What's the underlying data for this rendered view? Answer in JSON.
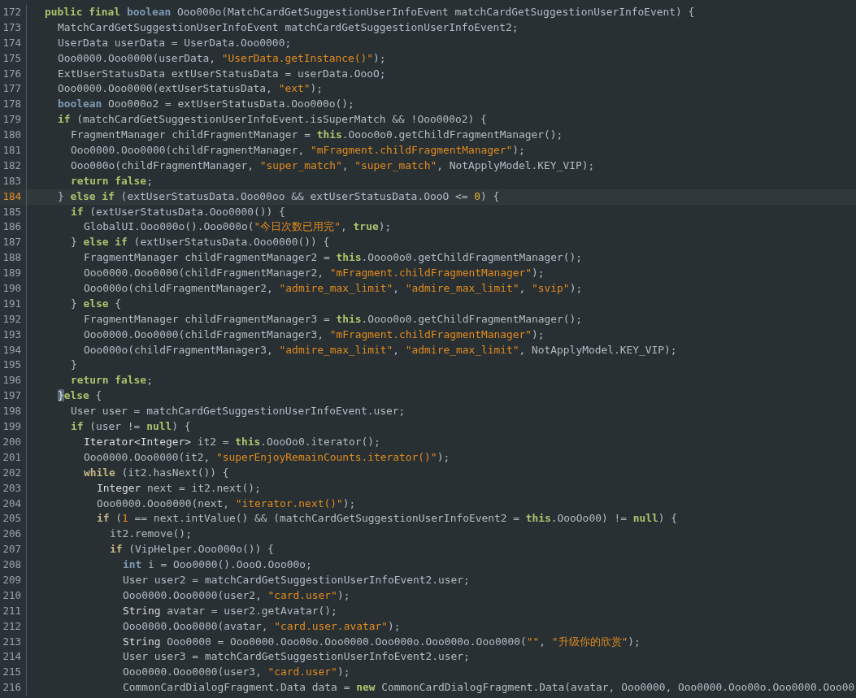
{
  "editor": {
    "lines": [
      {
        "number": "172",
        "current": false,
        "segments": [
          {
            "kind": "keyword",
            "text": "public final "
          },
          {
            "kind": "type",
            "text": "boolean"
          },
          {
            "kind": "plain",
            "text": " Ooo000o(MatchCardGetSuggestionUserInfoEvent matchCardGetSuggestionUserInfoEvent) {"
          }
        ]
      },
      {
        "number": "173",
        "current": false,
        "segments": [
          {
            "kind": "plain",
            "text": "MatchCardGetSuggestionUserInfoEvent matchCardGetSuggestionUserInfoEvent2;"
          }
        ]
      },
      {
        "number": "174",
        "current": false,
        "segments": [
          {
            "kind": "plain",
            "text": "UserData userData = UserData.Ooo0000;"
          }
        ]
      },
      {
        "number": "175",
        "current": false,
        "segments": [
          {
            "kind": "plain",
            "text": "Ooo0000.Ooo0000(userData, "
          },
          {
            "kind": "string",
            "text": "\"UserData.getInstance()\""
          },
          {
            "kind": "plain",
            "text": ");"
          }
        ]
      },
      {
        "number": "176",
        "current": false,
        "segments": [
          {
            "kind": "plain",
            "text": "ExtUserStatusData extUserStatusData = userData.OooO;"
          }
        ]
      },
      {
        "number": "177",
        "current": false,
        "segments": [
          {
            "kind": "plain",
            "text": "Ooo0000.Ooo0000(extUserStatusData, "
          },
          {
            "kind": "string",
            "text": "\"ext\""
          },
          {
            "kind": "plain",
            "text": ");"
          }
        ]
      },
      {
        "number": "178",
        "current": false,
        "segments": [
          {
            "kind": "type",
            "text": "boolean"
          },
          {
            "kind": "plain",
            "text": " Ooo000o2 = extUserStatusData.Ooo000o();"
          }
        ]
      },
      {
        "number": "179",
        "current": false,
        "segments": [
          {
            "kind": "keyword",
            "text": "if"
          },
          {
            "kind": "plain",
            "text": " (matchCardGetSuggestionUserInfoEvent.isSuperMatch && !Ooo000o2) {"
          }
        ]
      },
      {
        "number": "180",
        "current": false,
        "segments": [
          {
            "kind": "plain",
            "text": "FragmentManager childFragmentManager = "
          },
          {
            "kind": "keyword",
            "text": "this"
          },
          {
            "kind": "plain",
            "text": ".Oooo0o0.getChildFragmentManager();"
          }
        ]
      },
      {
        "number": "181",
        "current": false,
        "segments": [
          {
            "kind": "plain",
            "text": "Ooo0000.Ooo0000(childFragmentManager, "
          },
          {
            "kind": "string",
            "text": "\"mFragment.childFragmentManager\""
          },
          {
            "kind": "plain",
            "text": ");"
          }
        ]
      },
      {
        "number": "182",
        "current": false,
        "segments": [
          {
            "kind": "plain",
            "text": "Ooo000o(childFragmentManager, "
          },
          {
            "kind": "string",
            "text": "\"super_match\""
          },
          {
            "kind": "plain",
            "text": ", "
          },
          {
            "kind": "string",
            "text": "\"super_match\""
          },
          {
            "kind": "plain",
            "text": ", NotApplyModel.KEY_VIP);"
          }
        ]
      },
      {
        "number": "183",
        "current": false,
        "segments": [
          {
            "kind": "keyword",
            "text": "return false"
          },
          {
            "kind": "plain",
            "text": ";"
          }
        ]
      },
      {
        "number": "184",
        "current": true,
        "segments": [
          {
            "kind": "plain",
            "text": "} "
          },
          {
            "kind": "keyword",
            "text": "else if"
          },
          {
            "kind": "plain",
            "text": " (extUserStatusData.Ooo00oo && extUserStatusData.OooO <= "
          },
          {
            "kind": "number",
            "text": "0"
          },
          {
            "kind": "plain",
            "text": ") {"
          }
        ]
      },
      {
        "number": "185",
        "current": false,
        "segments": [
          {
            "kind": "keyword",
            "text": "if"
          },
          {
            "kind": "plain",
            "text": " (extUserStatusData.Ooo0000()) {"
          }
        ]
      },
      {
        "number": "186",
        "current": false,
        "segments": [
          {
            "kind": "plain",
            "text": "GlobalUI.Ooo000o().Ooo000o("
          },
          {
            "kind": "string",
            "text": "\"今日次数已用完\""
          },
          {
            "kind": "plain",
            "text": ", "
          },
          {
            "kind": "keyword",
            "text": "true"
          },
          {
            "kind": "plain",
            "text": ");"
          }
        ]
      },
      {
        "number": "187",
        "current": false,
        "segments": [
          {
            "kind": "plain",
            "text": "} "
          },
          {
            "kind": "keyword",
            "text": "else if"
          },
          {
            "kind": "plain",
            "text": " (extUserStatusData.Ooo0000()) {"
          }
        ]
      },
      {
        "number": "188",
        "current": false,
        "segments": [
          {
            "kind": "plain",
            "text": "FragmentManager childFragmentManager2 = "
          },
          {
            "kind": "keyword",
            "text": "this"
          },
          {
            "kind": "plain",
            "text": ".Oooo0o0.getChildFragmentManager();"
          }
        ]
      },
      {
        "number": "189",
        "current": false,
        "segments": [
          {
            "kind": "plain",
            "text": "Ooo0000.Ooo0000(childFragmentManager2, "
          },
          {
            "kind": "string",
            "text": "\"mFragment.childFragmentManager\""
          },
          {
            "kind": "plain",
            "text": ");"
          }
        ]
      },
      {
        "number": "190",
        "current": false,
        "segments": [
          {
            "kind": "plain",
            "text": "Ooo000o(childFragmentManager2, "
          },
          {
            "kind": "string",
            "text": "\"admire_max_limit\""
          },
          {
            "kind": "plain",
            "text": ", "
          },
          {
            "kind": "string",
            "text": "\"admire_max_limit\""
          },
          {
            "kind": "plain",
            "text": ", "
          },
          {
            "kind": "string",
            "text": "\"svip\""
          },
          {
            "kind": "plain",
            "text": ");"
          }
        ]
      },
      {
        "number": "191",
        "current": false,
        "segments": [
          {
            "kind": "plain",
            "text": "} "
          },
          {
            "kind": "keyword",
            "text": "else"
          },
          {
            "kind": "plain",
            "text": " {"
          }
        ]
      },
      {
        "number": "192",
        "current": false,
        "segments": [
          {
            "kind": "plain",
            "text": "FragmentManager childFragmentManager3 = "
          },
          {
            "kind": "keyword",
            "text": "this"
          },
          {
            "kind": "plain",
            "text": ".Oooo0o0.getChildFragmentManager();"
          }
        ]
      },
      {
        "number": "193",
        "current": false,
        "segments": [
          {
            "kind": "plain",
            "text": "Ooo0000.Ooo0000(childFragmentManager3, "
          },
          {
            "kind": "string",
            "text": "\"mFragment.childFragmentManager\""
          },
          {
            "kind": "plain",
            "text": ");"
          }
        ]
      },
      {
        "number": "194",
        "current": false,
        "segments": [
          {
            "kind": "plain",
            "text": "Ooo000o(childFragmentManager3, "
          },
          {
            "kind": "string",
            "text": "\"admire_max_limit\""
          },
          {
            "kind": "plain",
            "text": ", "
          },
          {
            "kind": "string",
            "text": "\"admire_max_limit\""
          },
          {
            "kind": "plain",
            "text": ", NotApplyModel.KEY_VIP);"
          }
        ]
      },
      {
        "number": "195",
        "current": false,
        "segments": [
          {
            "kind": "plain",
            "text": "}"
          }
        ]
      },
      {
        "number": "196",
        "current": false,
        "segments": [
          {
            "kind": "keyword",
            "text": "return false"
          },
          {
            "kind": "plain",
            "text": ";"
          }
        ]
      },
      {
        "number": "197",
        "current": false,
        "segments": [
          {
            "kind": "brace-match",
            "text": "}"
          },
          {
            "kind": "keyword",
            "text": "else"
          },
          {
            "kind": "plain",
            "text": " {"
          }
        ]
      },
      {
        "number": "198",
        "current": false,
        "segments": [
          {
            "kind": "plain",
            "text": "User user = matchCardGetSuggestionUserInfoEvent.user;"
          }
        ]
      },
      {
        "number": "199",
        "current": false,
        "segments": [
          {
            "kind": "keyword",
            "text": "if"
          },
          {
            "kind": "plain",
            "text": " (user != "
          },
          {
            "kind": "keyword",
            "text": "null"
          },
          {
            "kind": "plain",
            "text": ") {"
          }
        ]
      },
      {
        "number": "200",
        "current": false,
        "segments": [
          {
            "kind": "class",
            "text": "Iterator<Integer>"
          },
          {
            "kind": "plain",
            "text": " it2 = "
          },
          {
            "kind": "keyword",
            "text": "this"
          },
          {
            "kind": "plain",
            "text": ".OooOo0.iterator();"
          }
        ]
      },
      {
        "number": "201",
        "current": false,
        "segments": [
          {
            "kind": "plain",
            "text": "Ooo0000.Ooo0000(it2, "
          },
          {
            "kind": "string",
            "text": "\"superEnjoyRemainCounts.iterator()\""
          },
          {
            "kind": "plain",
            "text": ");"
          }
        ]
      },
      {
        "number": "202",
        "current": false,
        "segments": [
          {
            "kind": "flow",
            "text": "while"
          },
          {
            "kind": "plain",
            "text": " (it2.hasNext()) {"
          }
        ]
      },
      {
        "number": "203",
        "current": false,
        "segments": [
          {
            "kind": "class",
            "text": "Integer"
          },
          {
            "kind": "plain",
            "text": " next = it2.next();"
          }
        ]
      },
      {
        "number": "204",
        "current": false,
        "segments": [
          {
            "kind": "plain",
            "text": "Ooo0000.Ooo0000(next, "
          },
          {
            "kind": "string",
            "text": "\"iterator.next()\""
          },
          {
            "kind": "plain",
            "text": ");"
          }
        ]
      },
      {
        "number": "205",
        "current": false,
        "segments": [
          {
            "kind": "flow",
            "text": "if"
          },
          {
            "kind": "plain",
            "text": " ("
          },
          {
            "kind": "string",
            "text": "1"
          },
          {
            "kind": "plain",
            "text": " == next.intValue() && (matchCardGetSuggestionUserInfoEvent2 = "
          },
          {
            "kind": "keyword",
            "text": "this"
          },
          {
            "kind": "plain",
            "text": ".OooOo00) != "
          },
          {
            "kind": "keyword",
            "text": "null"
          },
          {
            "kind": "plain",
            "text": ") {"
          }
        ]
      },
      {
        "number": "206",
        "current": false,
        "segments": [
          {
            "kind": "plain",
            "text": "it2.remove();"
          }
        ]
      },
      {
        "number": "207",
        "current": false,
        "segments": [
          {
            "kind": "flow",
            "text": "if"
          },
          {
            "kind": "plain",
            "text": " (VipHelper.Ooo000o()) {"
          }
        ]
      },
      {
        "number": "208",
        "current": false,
        "segments": [
          {
            "kind": "type",
            "text": "int"
          },
          {
            "kind": "plain",
            "text": " i = Ooo0000().OooO.Ooo00o;"
          }
        ]
      },
      {
        "number": "209",
        "current": false,
        "segments": [
          {
            "kind": "plain",
            "text": "User user2 = matchCardGetSuggestionUserInfoEvent2.user;"
          }
        ]
      },
      {
        "number": "210",
        "current": false,
        "segments": [
          {
            "kind": "plain",
            "text": "Ooo0000.Ooo0000(user2, "
          },
          {
            "kind": "string",
            "text": "\"card.user\""
          },
          {
            "kind": "plain",
            "text": ");"
          }
        ]
      },
      {
        "number": "211",
        "current": false,
        "segments": [
          {
            "kind": "class",
            "text": "String"
          },
          {
            "kind": "plain",
            "text": " avatar = user2.getAvatar();"
          }
        ]
      },
      {
        "number": "212",
        "current": false,
        "segments": [
          {
            "kind": "plain",
            "text": "Ooo0000.Ooo0000(avatar, "
          },
          {
            "kind": "string",
            "text": "\"card.user.avatar\""
          },
          {
            "kind": "plain",
            "text": ");"
          }
        ]
      },
      {
        "number": "213",
        "current": false,
        "segments": [
          {
            "kind": "class",
            "text": "String"
          },
          {
            "kind": "plain",
            "text": " Ooo0000 = Ooo0000.Ooo00o.Ooo0000.Ooo000o.Ooo000o.Ooo0000("
          },
          {
            "kind": "string",
            "text": "\"\""
          },
          {
            "kind": "plain",
            "text": ", "
          },
          {
            "kind": "string",
            "text": "\"升级你的欣赏\""
          },
          {
            "kind": "plain",
            "text": ");"
          }
        ]
      },
      {
        "number": "214",
        "current": false,
        "segments": [
          {
            "kind": "plain",
            "text": "User user3 = matchCardGetSuggestionUserInfoEvent2.user;"
          }
        ]
      },
      {
        "number": "215",
        "current": false,
        "segments": [
          {
            "kind": "plain",
            "text": "Ooo0000.Ooo0000(user3, "
          },
          {
            "kind": "string",
            "text": "\"card.user\""
          },
          {
            "kind": "plain",
            "text": ");"
          }
        ]
      },
      {
        "number": "216",
        "current": false,
        "segments": [
          {
            "kind": "plain",
            "text": "CommonCardDialogFragment.Data data = "
          },
          {
            "kind": "keyword",
            "text": "new"
          },
          {
            "kind": "plain",
            "text": " CommonCardDialogFragment.Data(avatar, Ooo0000, Ooo0000.Ooo00o.Ooo0000.Ooo00"
          }
        ]
      }
    ]
  }
}
